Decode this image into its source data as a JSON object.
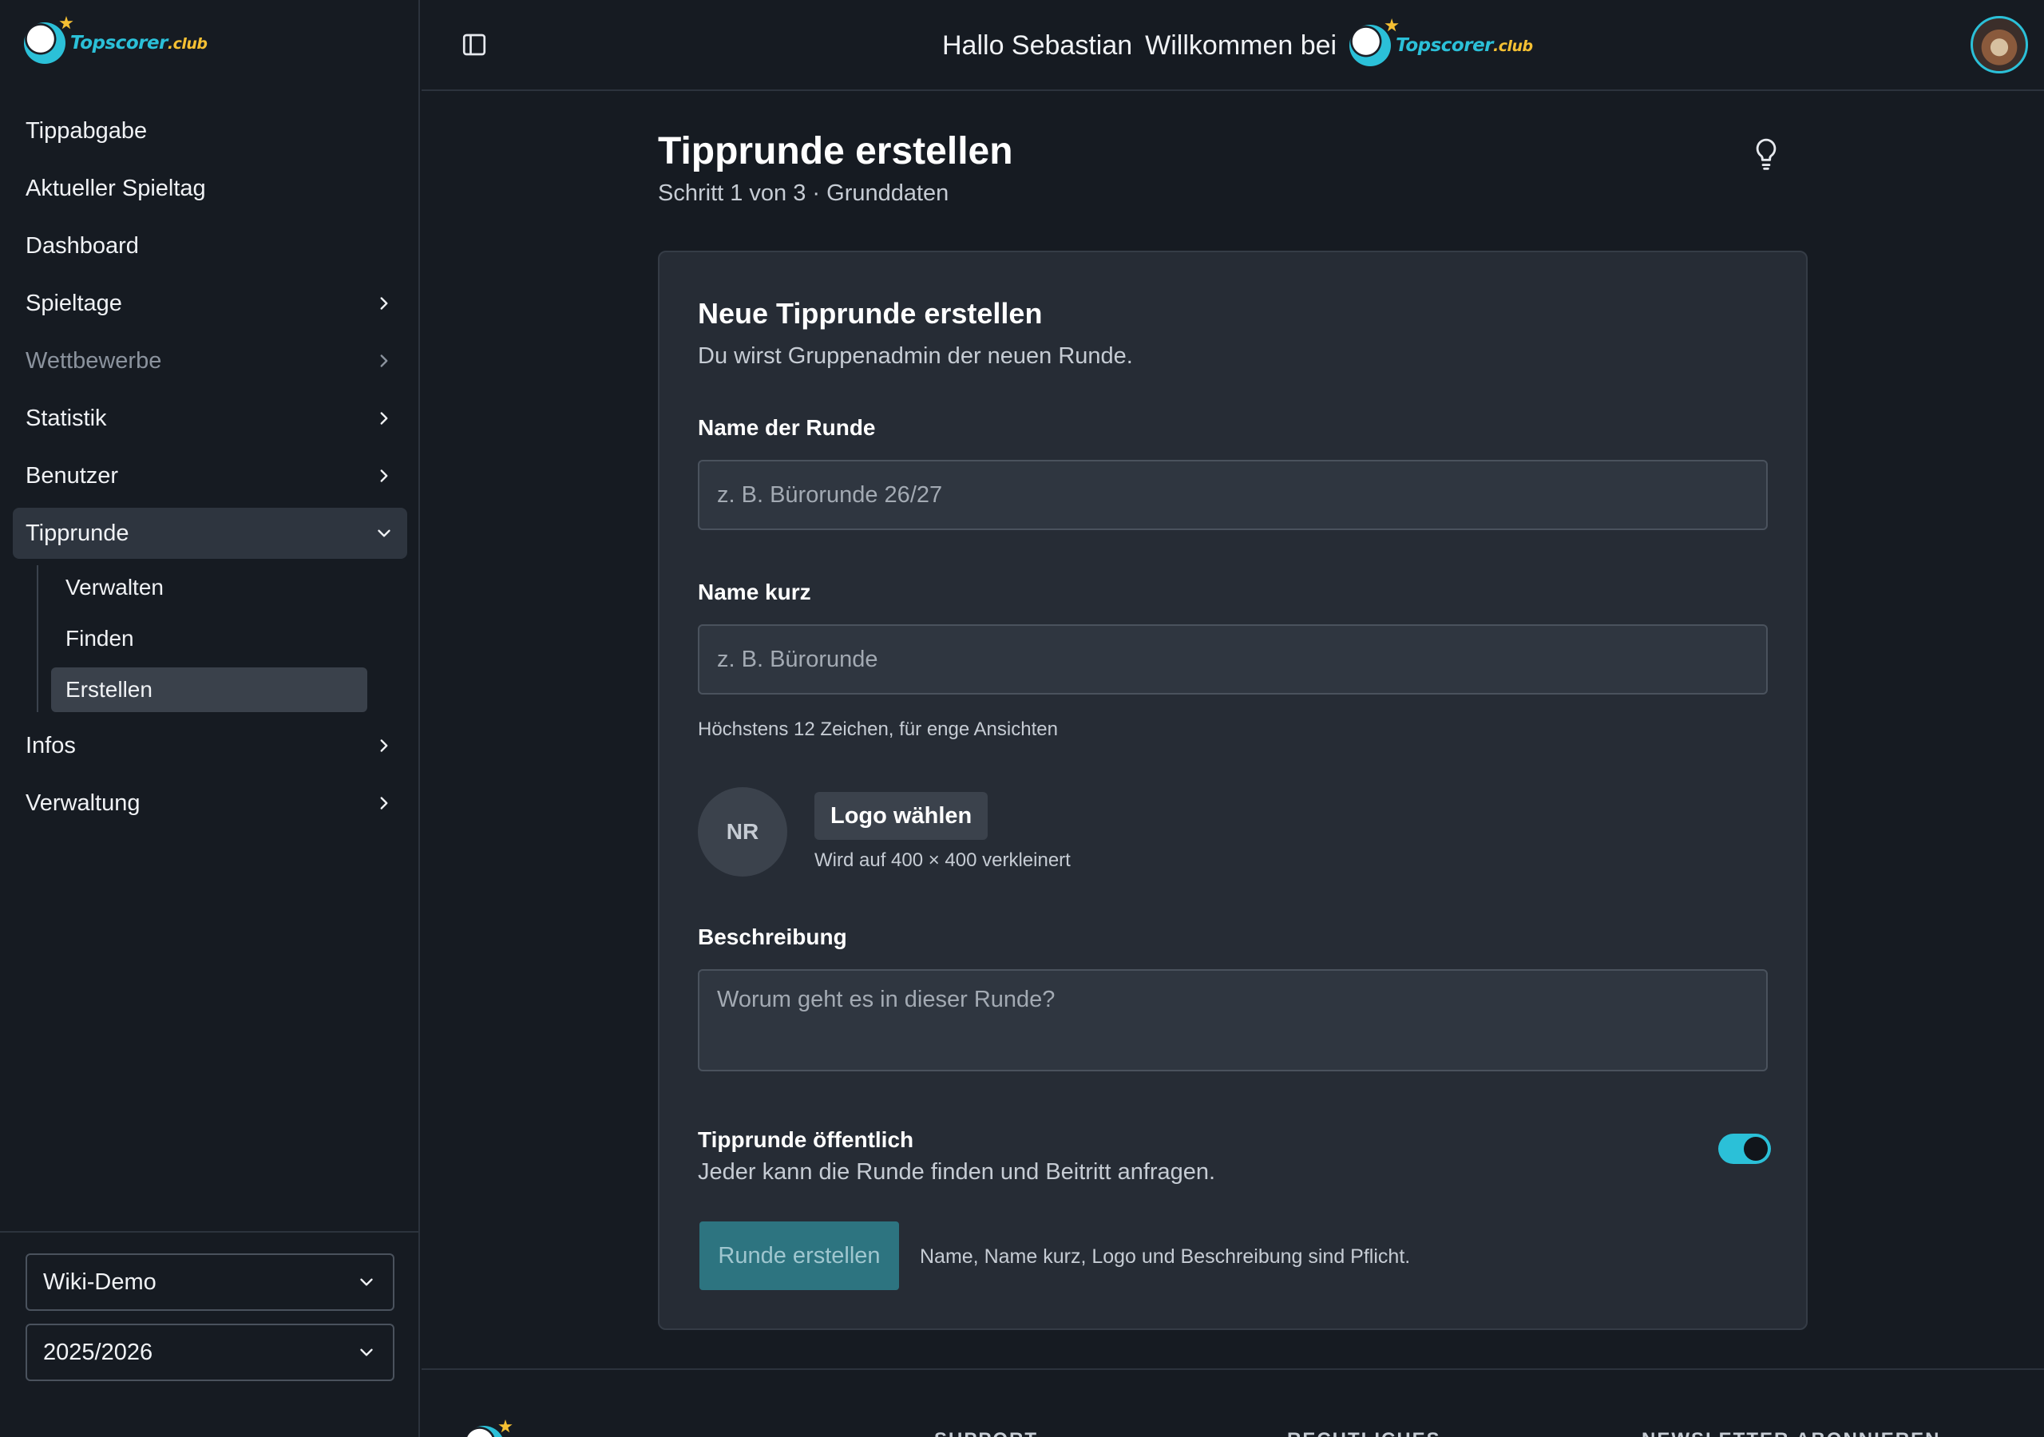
{
  "brand": {
    "name": "Topscorer",
    "suffix": ".club"
  },
  "header": {
    "greeting": "Hallo Sebastian",
    "welcome": "Willkommen bei"
  },
  "sidebar": {
    "items": [
      {
        "label": "Tippabgabe",
        "chevron": "none",
        "muted": false
      },
      {
        "label": "Aktueller Spieltag",
        "chevron": "none",
        "muted": false
      },
      {
        "label": "Dashboard",
        "chevron": "none",
        "muted": false
      },
      {
        "label": "Spieltage",
        "chevron": "right",
        "muted": false
      },
      {
        "label": "Wettbewerbe",
        "chevron": "right",
        "muted": true
      },
      {
        "label": "Statistik",
        "chevron": "right",
        "muted": false
      },
      {
        "label": "Benutzer",
        "chevron": "right",
        "muted": false
      },
      {
        "label": "Tipprunde",
        "chevron": "down",
        "muted": false,
        "active": true
      }
    ],
    "sub_items": [
      {
        "label": "Verwalten",
        "active": false
      },
      {
        "label": "Finden",
        "active": false
      },
      {
        "label": "Erstellen",
        "active": true
      }
    ],
    "items_after": [
      {
        "label": "Infos",
        "chevron": "right"
      },
      {
        "label": "Verwaltung",
        "chevron": "right"
      }
    ],
    "selects": {
      "league": "Wiki-Demo",
      "season": "2025/2026"
    }
  },
  "page": {
    "title": "Tipprunde erstellen",
    "subtitle": "Schritt 1 von 3 · Grunddaten"
  },
  "form": {
    "title": "Neue Tipprunde erstellen",
    "subtitle": "Du wirst Gruppenadmin der neuen Runde.",
    "name_label": "Name der Runde",
    "name_placeholder": "z. B. Bürorunde 26/27",
    "short_label": "Name kurz",
    "short_placeholder": "z. B. Bürorunde",
    "short_hint": "Höchstens 12 Zeichen, für enge Ansichten",
    "logo_initials": "NR",
    "logo_button": "Logo wählen",
    "logo_hint": "Wird auf 400 × 400 verkleinert",
    "desc_label": "Beschreibung",
    "desc_placeholder": "Worum geht es in dieser Runde?",
    "public_label": "Tipprunde öffentlich",
    "public_desc": "Jeder kann die Runde finden und Beitritt anfragen.",
    "public_enabled": true,
    "submit_label": "Runde erstellen",
    "submit_hint": "Name, Name kurz, Logo und Beschreibung sind Pflicht."
  },
  "footer": {
    "columns": [
      "SUPPORT",
      "RECHTLICHES",
      "NEWSLETTER ABONNIEREN"
    ]
  },
  "colors": {
    "accent": "#2bc0d8",
    "brand_gold": "#f5c033",
    "background": "#161b22",
    "card": "#262c35"
  },
  "icons": [
    "soccer-ball-logo-icon",
    "panel-toggle-icon",
    "lightbulb-icon",
    "chevron-right-icon",
    "chevron-down-icon",
    "avatar"
  ]
}
